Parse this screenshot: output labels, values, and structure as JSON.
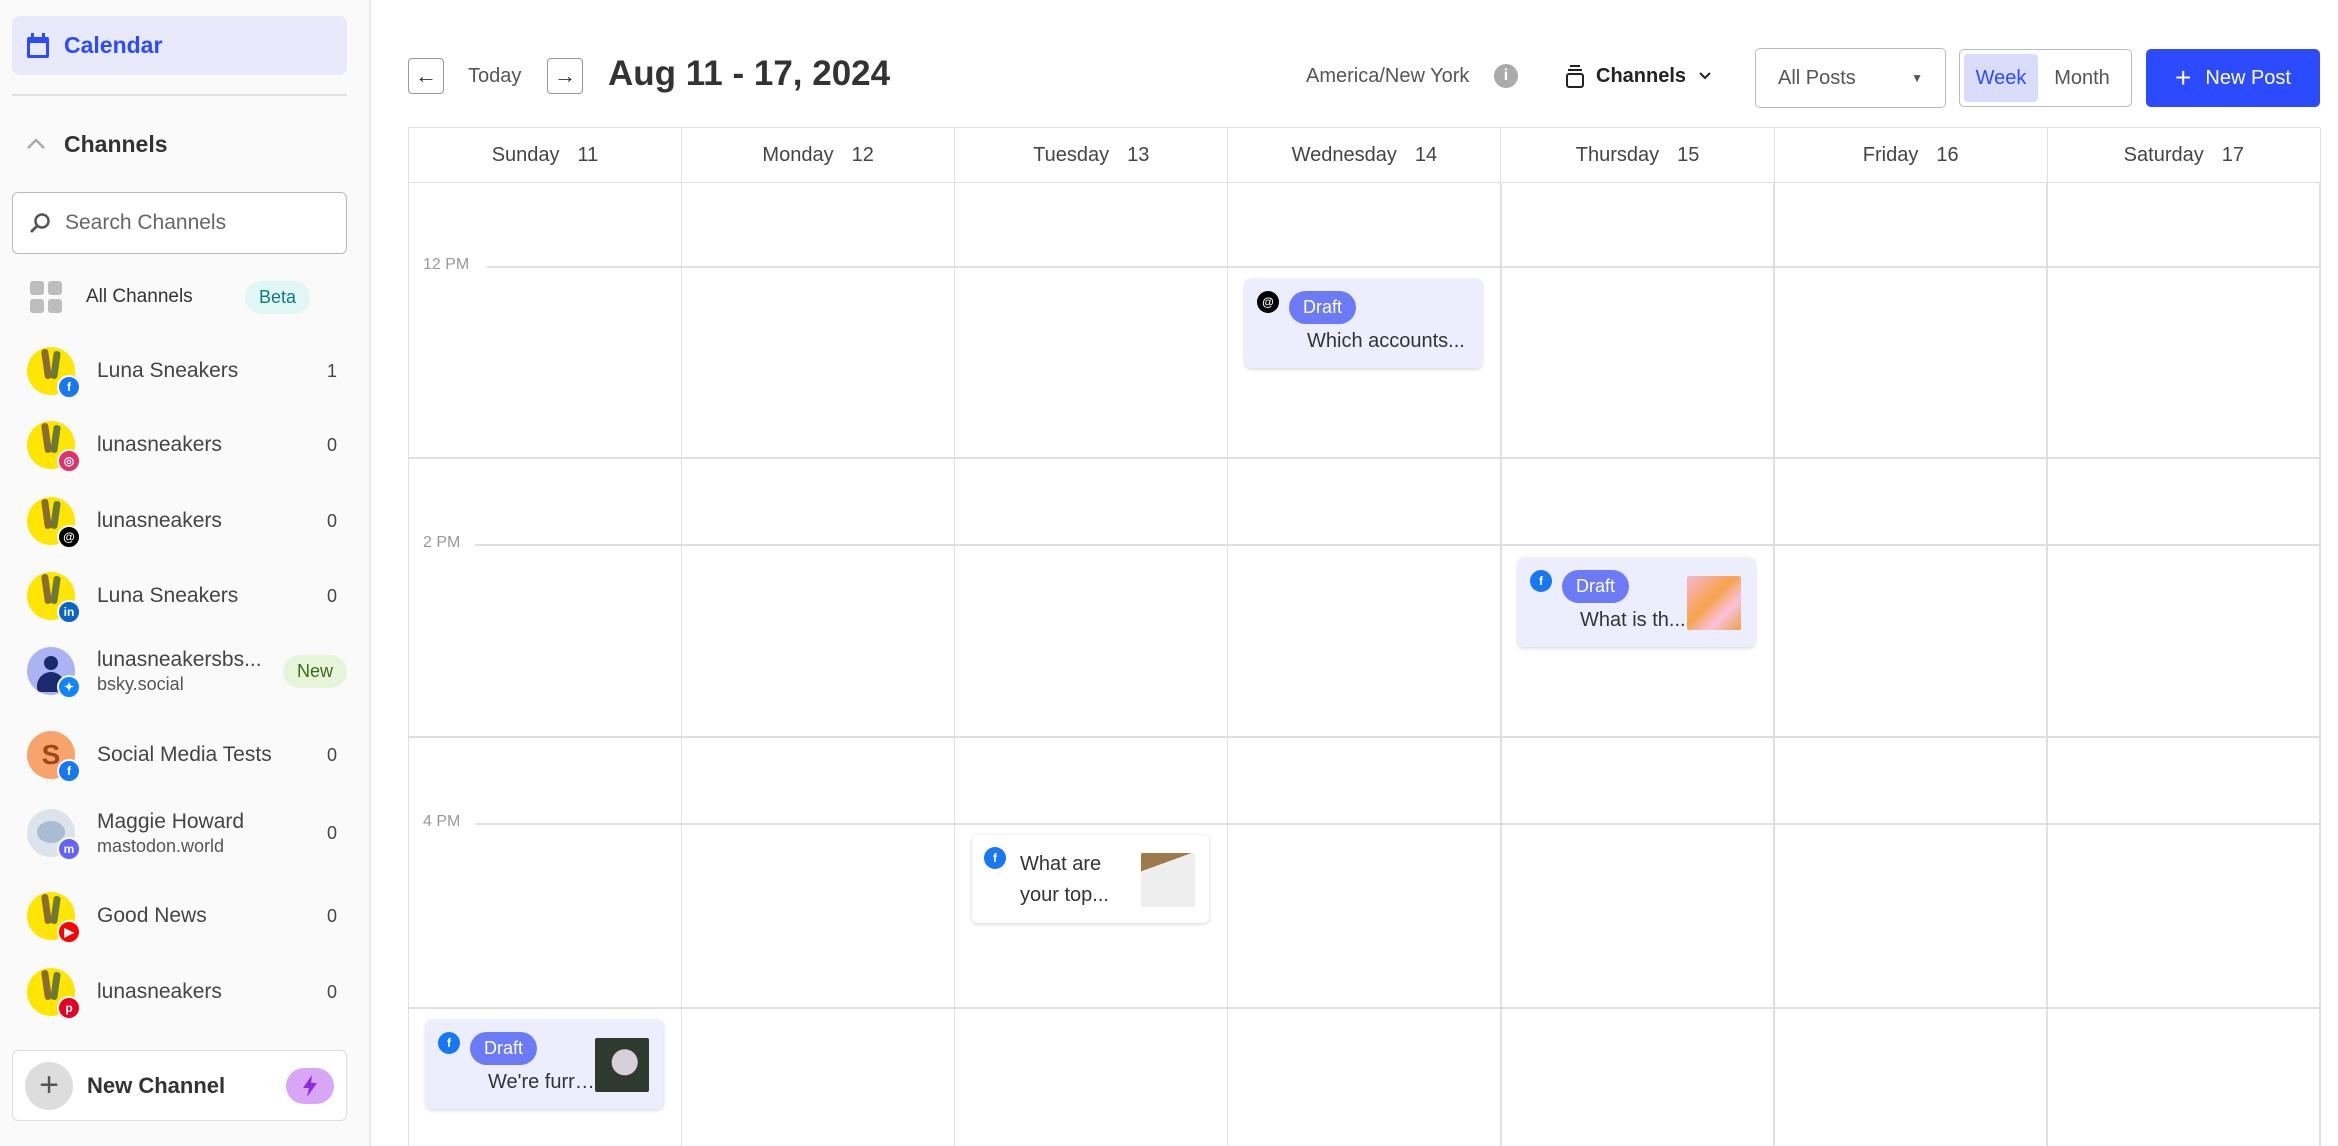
{
  "sidebar": {
    "calendar_label": "Calendar",
    "channels_header": "Channels",
    "search_placeholder": "Search Channels",
    "all_channels": {
      "label": "All Channels",
      "badge": "Beta"
    },
    "channels": [
      {
        "name": "Luna Sneakers",
        "platform": "facebook",
        "count": "1",
        "avatar": "yellow"
      },
      {
        "name": "lunasneakers",
        "platform": "instagram",
        "count": "0",
        "avatar": "yellow"
      },
      {
        "name": "lunasneakers",
        "platform": "threads",
        "count": "0",
        "avatar": "yellow"
      },
      {
        "name": "Luna Sneakers",
        "platform": "linkedin",
        "count": "0",
        "avatar": "yellow"
      },
      {
        "name": "lunasneakersbs...",
        "sub": "bsky.social",
        "platform": "bluesky",
        "badge": "New",
        "avatar": "person"
      },
      {
        "name": "Social Media Tests",
        "platform": "facebook",
        "count": "0",
        "avatar": "S"
      },
      {
        "name": "Maggie Howard",
        "sub": "mastodon.world",
        "platform": "mastodon",
        "count": "0",
        "avatar": "elephant"
      },
      {
        "name": "Good News",
        "platform": "youtube",
        "count": "0",
        "avatar": "yellow"
      },
      {
        "name": "lunasneakers",
        "platform": "pinterest",
        "count": "0",
        "avatar": "yellow"
      }
    ],
    "new_channel_label": "New Channel"
  },
  "header": {
    "today_label": "Today",
    "date_range": "Aug 11 - 17, 2024",
    "timezone": "America/New York",
    "channels_filter": "Channels",
    "posts_filter": "All Posts",
    "view_week": "Week",
    "view_month": "Month",
    "active_view": "Week",
    "new_post_label": "New Post"
  },
  "calendar": {
    "days": [
      {
        "name": "Sunday",
        "date": "11"
      },
      {
        "name": "Monday",
        "date": "12"
      },
      {
        "name": "Tuesday",
        "date": "13"
      },
      {
        "name": "Wednesday",
        "date": "14"
      },
      {
        "name": "Thursday",
        "date": "15"
      },
      {
        "name": "Friday",
        "date": "16"
      },
      {
        "name": "Saturday",
        "date": "17"
      }
    ],
    "time_labels": [
      "12 PM",
      "2 PM",
      "4 PM"
    ],
    "posts": [
      {
        "day": "Wednesday",
        "platform": "threads",
        "status": "Draft",
        "text": "Which accounts...",
        "thumbnail": ""
      },
      {
        "day": "Thursday",
        "platform": "facebook",
        "status": "Draft",
        "text": "What is th...",
        "thumbnail": "balloons"
      },
      {
        "day": "Tuesday",
        "platform": "facebook",
        "status": "",
        "text": "What are your top...",
        "thumbnail": "notebook"
      },
      {
        "day": "Sunday",
        "platform": "facebook",
        "status": "Draft",
        "text": "We're furr-...",
        "thumbnail": "dog"
      }
    ]
  },
  "colors": {
    "accent": "#2c4bff",
    "draft": "#6c7bf5",
    "draft_card_bg": "#eceefd",
    "facebook": "#1877f2",
    "instagram": "#e1306c",
    "threads": "#000000",
    "linkedin": "#0a66c2",
    "bluesky": "#1185fe",
    "mastodon": "#6364ff",
    "youtube": "#ff0000",
    "pinterest": "#e60023"
  }
}
